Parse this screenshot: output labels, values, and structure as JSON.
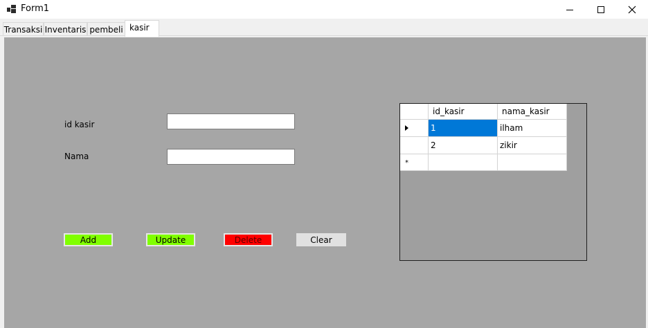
{
  "window": {
    "title": "Form1",
    "icons": [
      "app-icon",
      "minimize-icon",
      "maximize-icon",
      "close-icon"
    ]
  },
  "tabs": [
    {
      "label": "Transaksi",
      "active": false
    },
    {
      "label": "Inventaris",
      "active": false
    },
    {
      "label": "pembeli",
      "active": false
    },
    {
      "label": "kasir",
      "active": true
    }
  ],
  "form": {
    "id_label": "id kasir",
    "id_value": "",
    "name_label": "Nama",
    "name_value": ""
  },
  "buttons": {
    "add": "Add",
    "update": "Update",
    "delete": "Delete",
    "clear": "Clear"
  },
  "colors": {
    "panel": "#a6a6a6",
    "add_button": "#80ff00",
    "update_button": "#80ff00",
    "delete_button": "#ff0000",
    "clear_button": "#e1e1e1",
    "selected_cell": "#0078d7"
  },
  "grid": {
    "columns": [
      "id_kasir",
      "nama_kasir"
    ],
    "rows": [
      {
        "id_kasir": "1",
        "nama_kasir": "ilham",
        "current": true,
        "selected_cell": "id_kasir"
      },
      {
        "id_kasir": "2",
        "nama_kasir": "zikir",
        "current": false
      }
    ],
    "new_row_marker": "*"
  }
}
